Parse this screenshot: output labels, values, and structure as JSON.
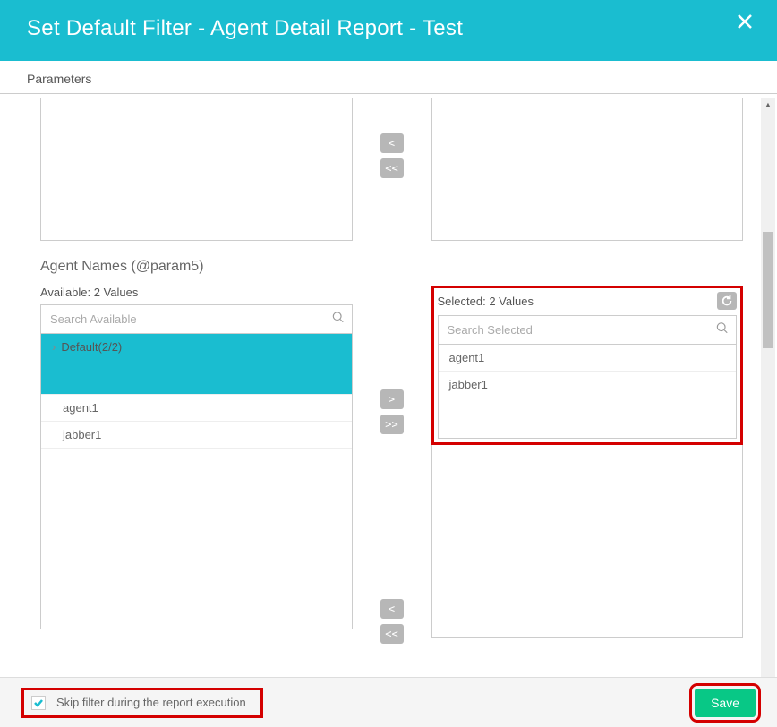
{
  "header": {
    "title": "Set Default Filter - Agent Detail Report - Test"
  },
  "tabs": {
    "parameters": "Parameters"
  },
  "buttons": {
    "move_right": ">",
    "move_all_right": ">>",
    "move_left": "<",
    "move_all_left": "<<",
    "save": "Save"
  },
  "agent_names": {
    "title": "Agent Names (@param5)",
    "available_label": "Available: 2 Values",
    "selected_label": "Selected: 2 Values",
    "search_available_ph": "Search Available",
    "search_selected_ph": "Search Selected",
    "available_group": "Default(2/2)",
    "available_items": [
      "agent1",
      "jabber1"
    ],
    "selected_items": [
      "agent1",
      "jabber1"
    ]
  },
  "skip_filter": {
    "checked": true,
    "label": "Skip filter during the report execution"
  }
}
